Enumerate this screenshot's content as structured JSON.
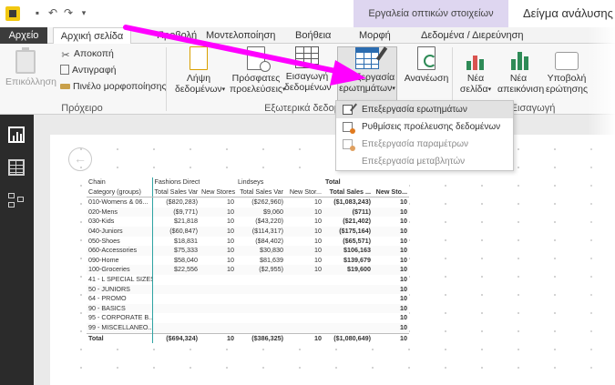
{
  "titlebar": {
    "context_group": "Εργαλεία οπτικών στοιχείων",
    "window_title": "Δείγμα ανάλυσης",
    "quick_access": [
      {
        "icon": "save-icon",
        "glyph": "▪"
      },
      {
        "icon": "undo-icon",
        "glyph": "↶"
      },
      {
        "icon": "redo-icon",
        "glyph": "↷"
      },
      {
        "icon": "customize-icon",
        "glyph": "▾"
      }
    ]
  },
  "tabs": {
    "file": "Αρχείο",
    "home": "Αρχική σελίδα",
    "view": "Προβολή",
    "modeling": "Μοντελοποίηση",
    "help": "Βοήθεια",
    "format": "Μορφή",
    "data_drill": "Δεδομένα / Διερεύνηση"
  },
  "ribbon": {
    "clipboard": {
      "paste": "Επικόλληση",
      "cut": "Αποκοπή",
      "copy": "Αντιγραφή",
      "format_painter": "Πινέλο μορφοποίησης",
      "label": "Πρόχειρο"
    },
    "external_data": {
      "get_data_l1": "Λήψη",
      "get_data_l2": "δεδομένων",
      "recent_l1": "Πρόσφατες",
      "recent_l2": "προελεύσεις",
      "enter_l1": "Εισαγωγή",
      "enter_l2": "δεδομένων",
      "edit_l1": "Επεξεργασία",
      "edit_l2": "ερωτημάτων",
      "refresh": "Ανανέωση",
      "label": "Εξωτερικά δεδομένα"
    },
    "insert": {
      "new_page_l1": "Νέα",
      "new_page_l2": "σελίδα",
      "new_visual_l1": "Νέα",
      "new_visual_l2": "απεικόνιση",
      "submit_l1": "Υποβολή",
      "submit_l2": "ερώτησης",
      "label": "Εισαγωγή"
    },
    "caret": "▾"
  },
  "menu": {
    "items": [
      "Επεξεργασία ερωτημάτων",
      "Ρυθμίσεις προέλευσης δεδομένων",
      "Επεξεργασία παραμέτρων",
      "Επεξεργασία μεταβλητών"
    ]
  },
  "canvas": {
    "back_glyph": "←"
  },
  "matrix": {
    "header1": [
      "Chain",
      "Fashions Direct",
      "",
      "Lindseys",
      "",
      "Total",
      ""
    ],
    "header2": [
      "Category (groups)",
      "Total Sales Var",
      "New Stores",
      "Total Sales Var",
      "New Stor...",
      "Total Sales ...",
      "New Sto..."
    ],
    "rows": [
      [
        "010-Womens & 06...",
        "($820,283)",
        "10",
        "($262,960)",
        "10",
        "($1,083,243)",
        "10"
      ],
      [
        "020-Mens",
        "($9,771)",
        "10",
        "$9,060",
        "10",
        "($711)",
        "10"
      ],
      [
        "030-Kids",
        "$21,818",
        "10",
        "($43,220)",
        "10",
        "($21,402)",
        "10"
      ],
      [
        "040-Juniors",
        "($60,847)",
        "10",
        "($114,317)",
        "10",
        "($175,164)",
        "10"
      ],
      [
        "050-Shoes",
        "$18,831",
        "10",
        "($84,402)",
        "10",
        "($65,571)",
        "10"
      ],
      [
        "060-Accessories",
        "$75,333",
        "10",
        "$30,830",
        "10",
        "$106,163",
        "10"
      ],
      [
        "090-Home",
        "$58,040",
        "10",
        "$81,639",
        "10",
        "$139,679",
        "10"
      ],
      [
        "100-Groceries",
        "$22,556",
        "10",
        "($2,955)",
        "10",
        "$19,600",
        "10"
      ],
      [
        "41 - L SPECIAL SIZES",
        "",
        "",
        "",
        "",
        "",
        "10"
      ],
      [
        "50 - JUNIORS",
        "",
        "",
        "",
        "",
        "",
        "10"
      ],
      [
        "64 - PROMO",
        "",
        "",
        "",
        "",
        "",
        "10"
      ],
      [
        "90 - BASICS",
        "",
        "",
        "",
        "",
        "",
        "10"
      ],
      [
        "95 - CORPORATE B...",
        "",
        "",
        "",
        "",
        "",
        "10"
      ],
      [
        "99 - MISCELLANEO...",
        "",
        "",
        "",
        "",
        "",
        "10"
      ]
    ],
    "total": [
      "Total",
      "($694,324)",
      "10",
      "($386,325)",
      "10",
      "($1,080,649)",
      "10"
    ]
  },
  "colors": {
    "highlight_arrow": "#ff00ff",
    "context_tab": "#ded6f0",
    "file_tab": "#3c3c3c",
    "left_nav": "#2b2b2b",
    "selection_accent": "#2fa3a3",
    "app_icon": "#f2c811"
  }
}
